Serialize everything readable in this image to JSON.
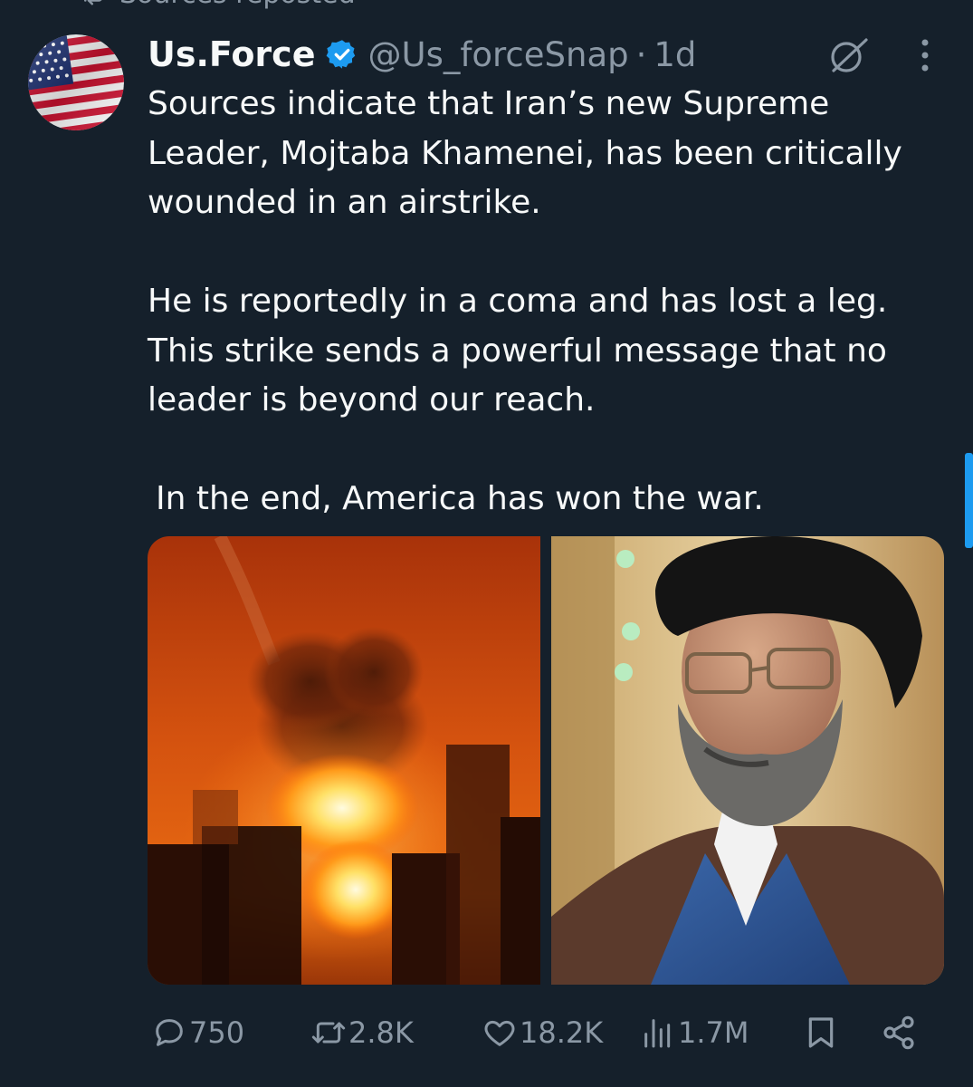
{
  "repost_header": {
    "text": "Sources reposted"
  },
  "post": {
    "display_name": "Us.Force",
    "handle": "@Us_forceSnap",
    "separator": "·",
    "time": "1d",
    "text_lines": [
      "Sources indicate that Iran’s new Supreme",
      "Leader, Mojtaba Khamenei, has been critically",
      "wounded in an airstrike.",
      "",
      "He is reportedly in a coma and has lost a leg.",
      "This strike sends a powerful message that no",
      "leader is beyond our reach.",
      "",
      "In the end, America has won the war."
    ]
  },
  "actions": {
    "replies": "750",
    "reposts": "2.8K",
    "likes": "18.2K",
    "views": "1.7M"
  },
  "icons": {
    "avatar": "us-flag",
    "verified": "verified-badge-icon",
    "grok": "grok-icon",
    "more": "more-vertical-icon",
    "reply": "reply-icon",
    "repost": "repost-icon",
    "like": "heart-icon",
    "views": "views-chart-icon",
    "bookmark": "bookmark-icon",
    "share": "share-icon"
  },
  "colors": {
    "background": "#15202b",
    "primary_text": "#f7f9f9",
    "secondary_text": "#8b98a5",
    "accent": "#1d9bf0"
  }
}
